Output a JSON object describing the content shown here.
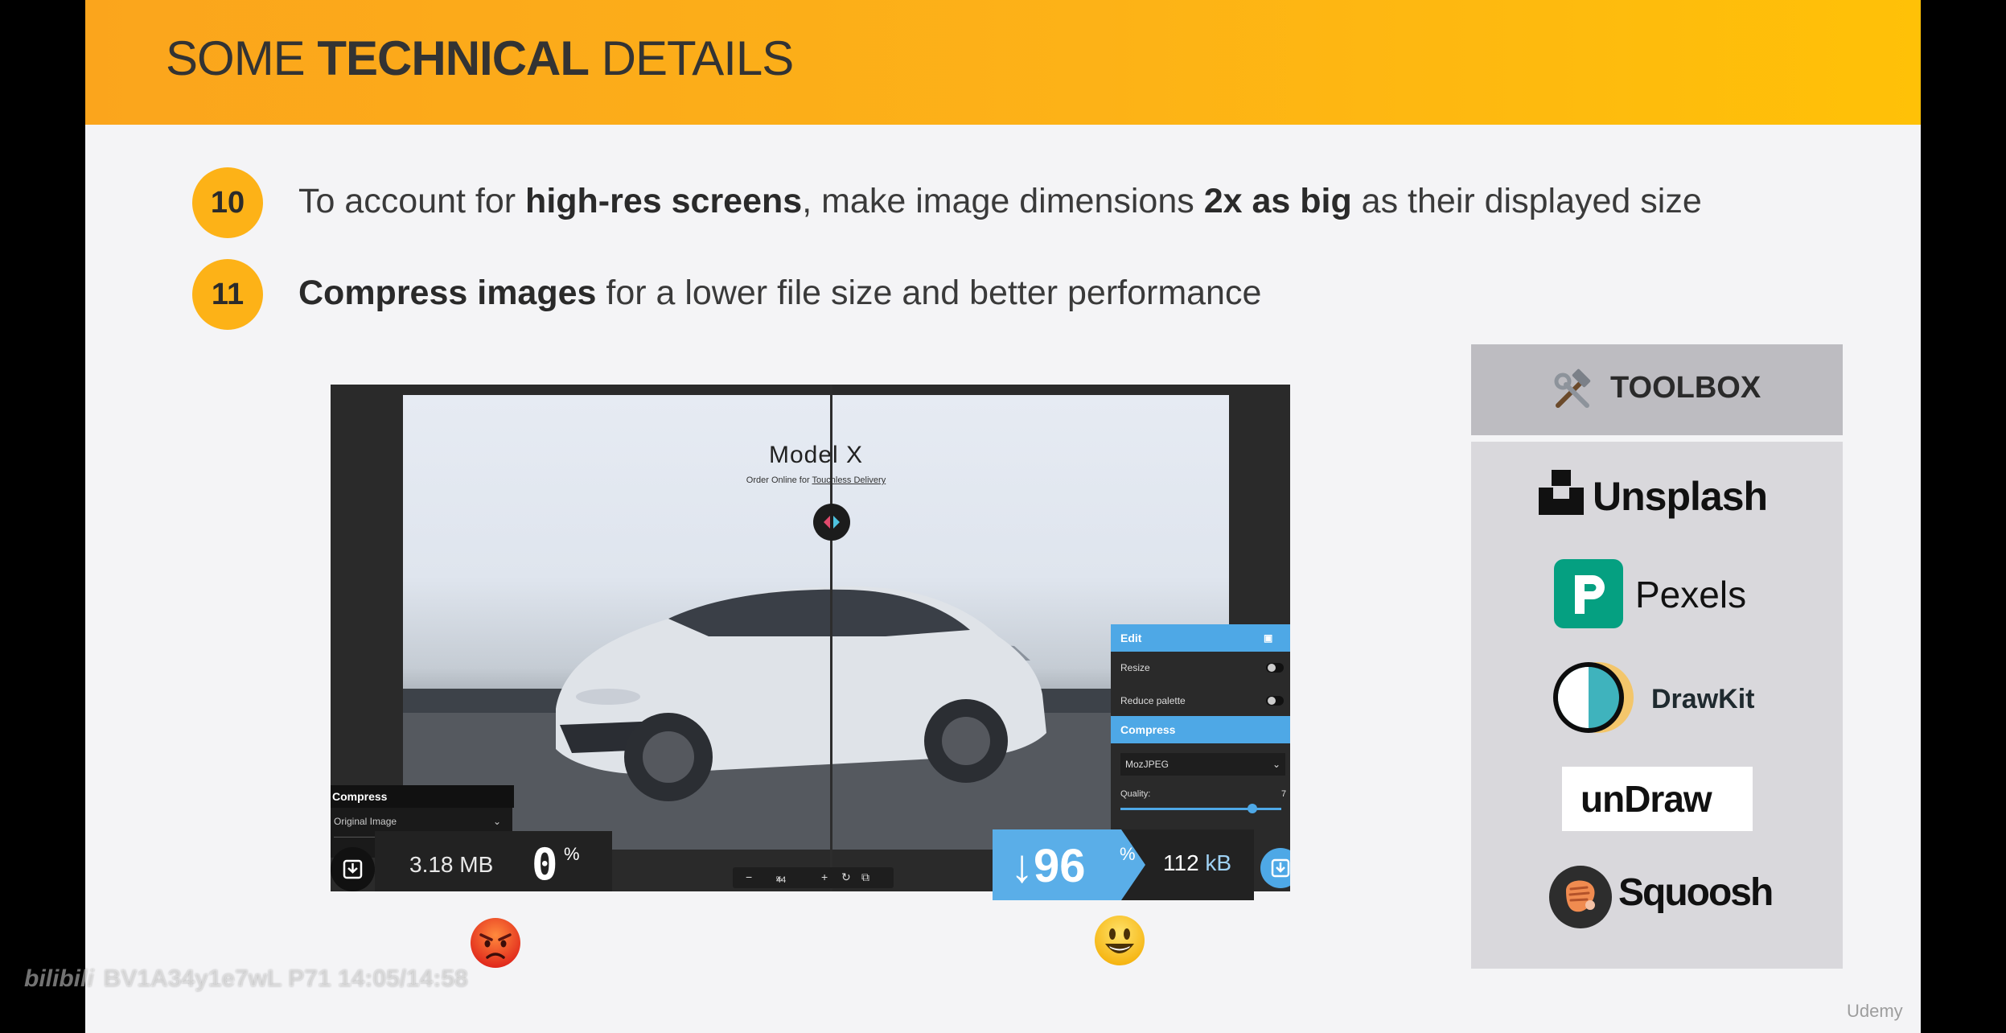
{
  "header": {
    "title_pre": "SOME ",
    "title_bold": "TECHNICAL",
    "title_post": " DETAILS"
  },
  "bullets": [
    {
      "number": "10",
      "t1": "To account for ",
      "b1": "high-res screens",
      "t2": ", make image dimensions ",
      "b2": "2x as big",
      "t3": " as their displayed size"
    },
    {
      "number": "11",
      "b1": "Compress images",
      "t1": " for a lower file size and better performance"
    }
  ],
  "demo": {
    "model_title": "Model X",
    "model_sub_pre": "Order Online for ",
    "model_sub_link": "Touchless Delivery",
    "zoom": "44",
    "zoom_unit": "%",
    "left_panel": {
      "title": "Compress",
      "select": "Original Image",
      "size": "3.18 MB",
      "percent": "0",
      "percent_sign": "%"
    },
    "right_panel": {
      "edit_title": "Edit",
      "resize": "Resize",
      "reduce_palette": "Reduce palette",
      "compress_title": "Compress",
      "codec": "MozJPEG",
      "quality_label": "Quality:",
      "quality_value": "7",
      "percent": "↓96",
      "percent_sign": "%",
      "size_num": "112",
      "size_unit": "kB"
    }
  },
  "toolbox": {
    "title": "TOOLBOX",
    "items": [
      "Unsplash",
      "Pexels",
      "DrawKit",
      "unDraw",
      "Squoosh"
    ]
  },
  "overlay": {
    "watermark": "BV1A34y1e7wL P71 14:05/14:58",
    "udemy": "Udemy"
  },
  "colors": {
    "accent": "#fdb217",
    "squoosh_blue": "#4ea8e6",
    "pexels_green": "#05a081"
  },
  "icons": {
    "toolbox_icon": "hammer-wrench-icon",
    "angry_face": "angry-face-icon",
    "smiley_face": "smiley-face-icon"
  }
}
